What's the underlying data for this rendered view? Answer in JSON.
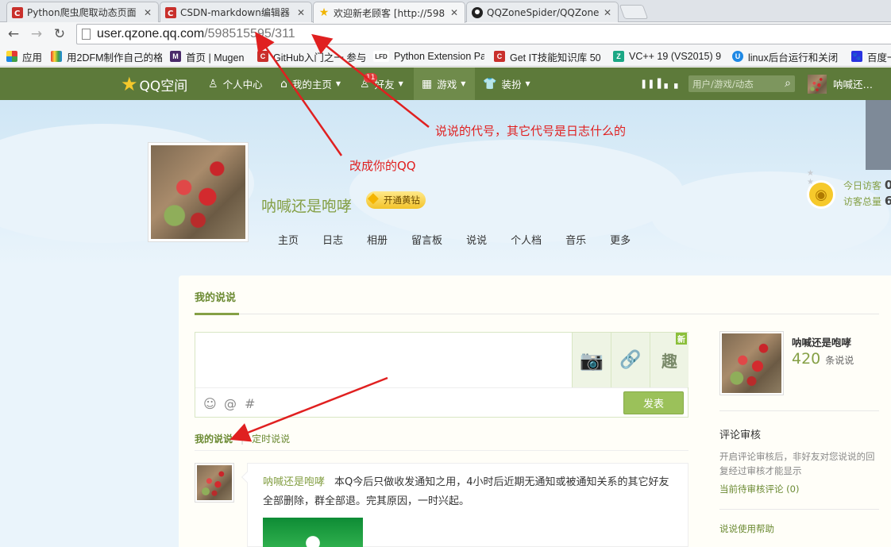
{
  "browser": {
    "tabs": [
      {
        "label": "Python爬虫爬取动态页面",
        "icon": "csdn-icon",
        "color": "#c9302c"
      },
      {
        "label": "CSDN-markdown编辑器",
        "icon": "csdn-icon",
        "color": "#c9302c"
      },
      {
        "label": "欢迎新老顾客 [http://598",
        "icon": "star-icon",
        "color": "#f0b400"
      },
      {
        "label": "QQZoneSpider/QQZone",
        "icon": "github-icon",
        "color": "#222222"
      }
    ],
    "url_host": "user.qzone.qq.com",
    "url_path": "/598515595/311",
    "bookmarks": [
      {
        "label": "应用"
      },
      {
        "label": "用2DFM制作自己的格"
      },
      {
        "label": "首页 | Mugen"
      },
      {
        "label": "GitHub入门之一 参与"
      },
      {
        "label": "Python Extension Pa"
      },
      {
        "label": "Get IT技能知识库 50"
      },
      {
        "label": "VC++ 19 (VS2015) 9"
      },
      {
        "label": "linux后台运行和关闭"
      },
      {
        "label": "百度一"
      }
    ]
  },
  "qzone": {
    "logo": "QQ空间",
    "nav": {
      "center": "个人中心",
      "home": "我的主页",
      "friends": "好友",
      "friends_badge": "11",
      "games": "游戏",
      "dress": "装扮",
      "search_placeholder": "用户/游戏/动态",
      "user": "呐喊还…"
    },
    "profile": {
      "name": "呐喊还是咆哮",
      "vip_label": "开通黄钻",
      "tabs": [
        "主页",
        "日志",
        "相册",
        "留言板",
        "说说",
        "个人档",
        "音乐",
        "更多"
      ],
      "today_visits_label": "今日访客",
      "today_visits_value": "0",
      "total_visits_label": "访客总量",
      "total_visits_value": "6"
    },
    "main": {
      "title": "我的说说",
      "post_button": "发表",
      "new_flag": "新",
      "fun_label": "趣",
      "subtab_mine": "我的说说",
      "subtab_sep": "|",
      "subtab_timed": "定时说说"
    },
    "feed": [
      {
        "author": "呐喊还是咆哮",
        "text": "本Q今后只做收发通知之用，4小时后近期无通知或被通知关系的其它好友全部删除，群全部退。完其原因，一时兴起。"
      }
    ],
    "side": {
      "name": "呐喊还是咆哮",
      "count": "420",
      "count_unit": "条说说",
      "review_title": "评论审核",
      "review_desc": "开启评论审核后，非好友对您说说的回复经过审核才能显示",
      "pending": "当前待审核评论 (0)",
      "help": "说说使用帮助"
    }
  },
  "annotations": {
    "note1": "说说的代号，其它代号是日志什么的",
    "note2": "改成你的QQ"
  }
}
